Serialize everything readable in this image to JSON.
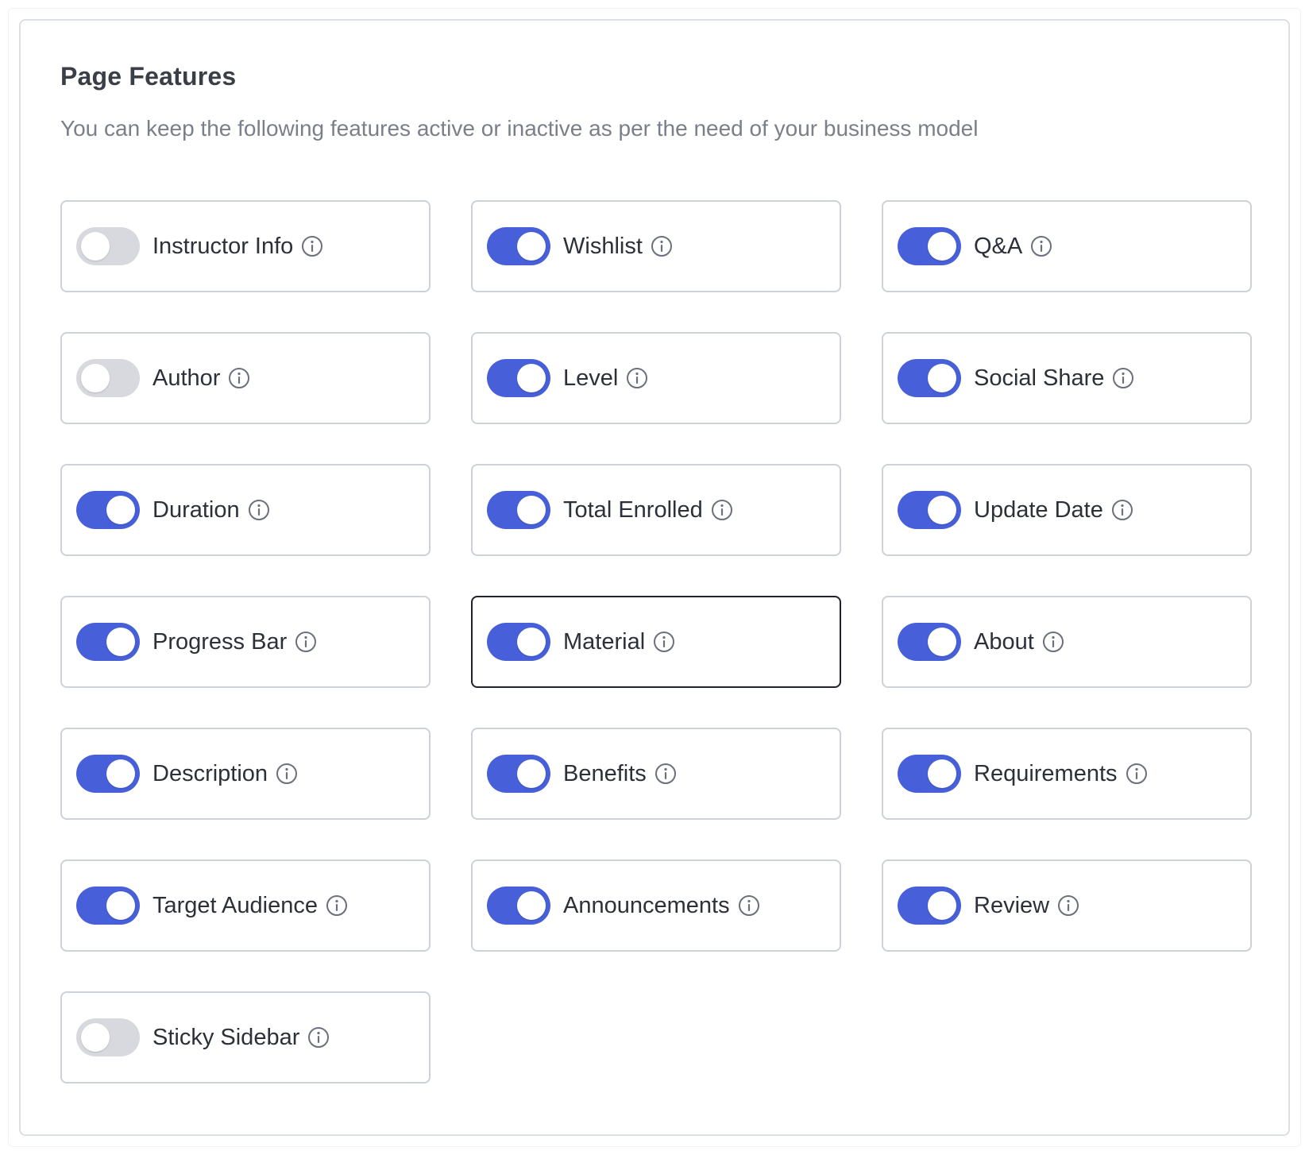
{
  "page": {
    "title": "Page Features",
    "subtitle": "You can keep the following features active or inactive as per the need of your business model"
  },
  "colors": {
    "toggle_on": "#4760d9",
    "toggle_off": "#d7d9de"
  },
  "features": [
    {
      "label": "Instructor Info",
      "enabled": false
    },
    {
      "label": "Wishlist",
      "enabled": true
    },
    {
      "label": "Q&A",
      "enabled": true
    },
    {
      "label": "Author",
      "enabled": false
    },
    {
      "label": "Level",
      "enabled": true
    },
    {
      "label": "Social Share",
      "enabled": true
    },
    {
      "label": "Duration",
      "enabled": true
    },
    {
      "label": "Total Enrolled",
      "enabled": true
    },
    {
      "label": "Update Date",
      "enabled": true
    },
    {
      "label": "Progress Bar",
      "enabled": true
    },
    {
      "label": "Material",
      "enabled": true,
      "focused": true
    },
    {
      "label": "About",
      "enabled": true
    },
    {
      "label": "Description",
      "enabled": true
    },
    {
      "label": "Benefits",
      "enabled": true
    },
    {
      "label": "Requirements",
      "enabled": true
    },
    {
      "label": "Target Audience",
      "enabled": true
    },
    {
      "label": "Announcements",
      "enabled": true
    },
    {
      "label": "Review",
      "enabled": true
    },
    {
      "label": "Sticky Sidebar",
      "enabled": false
    }
  ],
  "icons": {
    "info": "info-icon"
  }
}
